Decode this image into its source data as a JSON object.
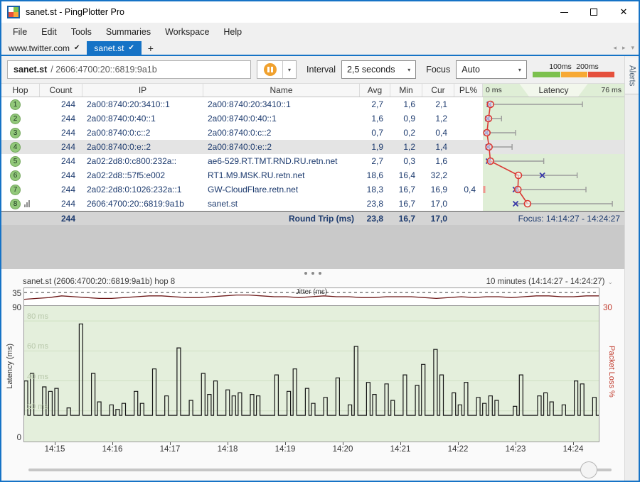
{
  "window": {
    "title": "sanet.st - PingPlotter Pro",
    "close_glyph": "✕"
  },
  "menu": {
    "items": [
      "File",
      "Edit",
      "Tools",
      "Summaries",
      "Workspace",
      "Help"
    ]
  },
  "tabs": {
    "check_glyph": "✔",
    "items": [
      {
        "label": "www.twitter.com"
      },
      {
        "label": "sanet.st"
      }
    ],
    "new_tab_glyph": "+",
    "nav": {
      "prev": "◂",
      "next": "▸",
      "menu": "▾"
    }
  },
  "toolbar": {
    "target": {
      "host": "sanet.st",
      "address": "/ 2606:4700:20::6819:9a1b"
    },
    "dropdown_glyph": "▾",
    "interval_label": "Interval",
    "interval_value": "2,5 seconds",
    "focus_label": "Focus",
    "focus_value": "Auto",
    "legend": {
      "labels": [
        "100ms",
        "200ms"
      ],
      "colors": [
        "#7cc14e",
        "#f7a934",
        "#e5503c"
      ]
    }
  },
  "alerts_label": "Alerts",
  "table": {
    "headers": [
      "Hop",
      "Count",
      "IP",
      "Name",
      "Avg",
      "Min",
      "Cur",
      "PL%"
    ],
    "latency_header": {
      "left": "0 ms",
      "title": "Latency",
      "right": "76 ms"
    },
    "hops": [
      {
        "hop": "1",
        "count": "244",
        "ip": "2a00:8740:20:3410::1",
        "name": "2a00:8740:20:3410::1",
        "avg": "2,7",
        "min": "1,6",
        "cur": "2,1",
        "pl": "",
        "selected": false,
        "has_history_icon": false
      },
      {
        "hop": "2",
        "count": "244",
        "ip": "2a00:8740:0:40::1",
        "name": "2a00:8740:0:40::1",
        "avg": "1,6",
        "min": "0,9",
        "cur": "1,2",
        "pl": "",
        "selected": false,
        "has_history_icon": false
      },
      {
        "hop": "3",
        "count": "244",
        "ip": "2a00:8740:0:c::2",
        "name": "2a00:8740:0:c::2",
        "avg": "0,7",
        "min": "0,2",
        "cur": "0,4",
        "pl": "",
        "selected": false,
        "has_history_icon": false
      },
      {
        "hop": "4",
        "count": "244",
        "ip": "2a00:8740:0:e::2",
        "name": "2a00:8740:0:e::2",
        "avg": "1,9",
        "min": "1,2",
        "cur": "1,4",
        "pl": "",
        "selected": true,
        "has_history_icon": false
      },
      {
        "hop": "5",
        "count": "244",
        "ip": "2a02:2d8:0:c800:232a::",
        "name": "ae6-529.RT.TMT.RND.RU.retn.net",
        "avg": "2,7",
        "min": "0,3",
        "cur": "1,6",
        "pl": "",
        "selected": false,
        "has_history_icon": false
      },
      {
        "hop": "6",
        "count": "244",
        "ip": "2a02:2d8::57f5:e002",
        "name": "RT1.M9.MSK.RU.retn.net",
        "avg": "18,6",
        "min": "16,4",
        "cur": "32,2",
        "pl": "",
        "selected": false,
        "has_history_icon": false
      },
      {
        "hop": "7",
        "count": "244",
        "ip": "2a02:2d8:0:1026:232a::1",
        "name": "GW-CloudFlare.retn.net",
        "avg": "18,3",
        "min": "16,7",
        "cur": "16,9",
        "pl": "0,4",
        "selected": false,
        "has_history_icon": false
      },
      {
        "hop": "8",
        "count": "244",
        "ip": "2606:4700:20::6819:9a1b",
        "name": "sanet.st",
        "avg": "23,8",
        "min": "16,7",
        "cur": "17,0",
        "pl": "",
        "selected": false,
        "has_history_icon": true
      }
    ],
    "footer": {
      "count": "244",
      "label": "Round Trip (ms)",
      "avg": "23,8",
      "min": "16,7",
      "cur": "17,0",
      "focus": "Focus: 14:14:27 - 14:24:27"
    }
  },
  "lower": {
    "header_left": "sanet.st (2606:4700:20::6819:9a1b) hop 8",
    "header_right": "10 minutes (14:14:27 - 14:24:27)",
    "header_chevron": "⌄",
    "jitter_axis_max": "35",
    "y_top": "90",
    "y_bottom": "0",
    "pl_axis_max": "30",
    "y_label": "Latency (ms)",
    "pl_label": "Packet Loss %"
  },
  "chart_data": [
    {
      "name": "hop-latency",
      "type": "scatter",
      "title": "Latency",
      "xlim": [
        0,
        76
      ],
      "hops": [
        {
          "hop": 1,
          "min": 1.6,
          "avg": 2.7,
          "cur": 2.1,
          "max": 55,
          "loss": false
        },
        {
          "hop": 2,
          "min": 0.9,
          "avg": 1.6,
          "cur": 1.2,
          "max": 9,
          "loss": false
        },
        {
          "hop": 3,
          "min": 0.2,
          "avg": 0.7,
          "cur": 0.4,
          "max": 17,
          "loss": false
        },
        {
          "hop": 4,
          "min": 1.2,
          "avg": 1.9,
          "cur": 1.4,
          "max": 15,
          "loss": false
        },
        {
          "hop": 5,
          "min": 0.3,
          "avg": 2.7,
          "cur": 1.6,
          "max": 33,
          "loss": false
        },
        {
          "hop": 6,
          "min": 16.4,
          "avg": 18.6,
          "cur": 32.2,
          "max": 52,
          "loss": false
        },
        {
          "hop": 7,
          "min": 16.7,
          "avg": 18.3,
          "cur": 16.9,
          "max": 57,
          "loss": true
        },
        {
          "hop": 8,
          "min": 16.7,
          "avg": 23.8,
          "cur": 17.0,
          "max": 72,
          "loss": false
        }
      ]
    },
    {
      "name": "latency-timeline",
      "type": "bar",
      "ylabel": "Latency (ms)",
      "y2label": "Packet Loss %",
      "ylim": [
        0,
        90
      ],
      "y2lim": [
        0,
        30
      ],
      "baseline": 17,
      "grid": [
        80,
        60,
        40,
        20
      ],
      "grid_labels": [
        "80 ms",
        "60 ms",
        "40 ms",
        "20 ms"
      ],
      "x_ticks": [
        "14:15",
        "14:16",
        "14:17",
        "14:18",
        "14:19",
        "14:20",
        "14:21",
        "14:22",
        "14:23",
        "14:24"
      ],
      "values": [
        40,
        45,
        17,
        36,
        33,
        35,
        17,
        22,
        17,
        78,
        17,
        45,
        26,
        17,
        24,
        21,
        25,
        17,
        33,
        25,
        17,
        48,
        17,
        30,
        17,
        62,
        17,
        27,
        17,
        45,
        31,
        40,
        17,
        34,
        30,
        32,
        17,
        31,
        30,
        17,
        17,
        44,
        17,
        33,
        48,
        17,
        35,
        25,
        17,
        29,
        17,
        42,
        17,
        24,
        63,
        17,
        39,
        31,
        17,
        38,
        27,
        17,
        44,
        17,
        37,
        51,
        17,
        61,
        44,
        17,
        32,
        24,
        39,
        17,
        29,
        25,
        30,
        27,
        17,
        17,
        23,
        44,
        17,
        17,
        30,
        32,
        26,
        17,
        24,
        17,
        40,
        38,
        17,
        29
      ]
    },
    {
      "name": "jitter",
      "type": "line",
      "title": "Jitter (ms)",
      "threshold": 35,
      "ylim": [
        20,
        40
      ],
      "values": [
        27,
        28,
        29,
        31,
        30,
        29,
        28,
        28,
        29,
        30,
        31,
        31,
        30,
        29,
        29,
        30,
        31,
        32,
        32,
        31,
        30,
        30,
        29,
        30,
        31,
        30,
        30,
        29,
        29,
        30,
        30,
        30,
        29,
        28,
        29,
        30,
        29,
        30,
        30,
        29,
        30,
        31,
        31,
        30,
        30,
        31,
        31
      ]
    }
  ]
}
